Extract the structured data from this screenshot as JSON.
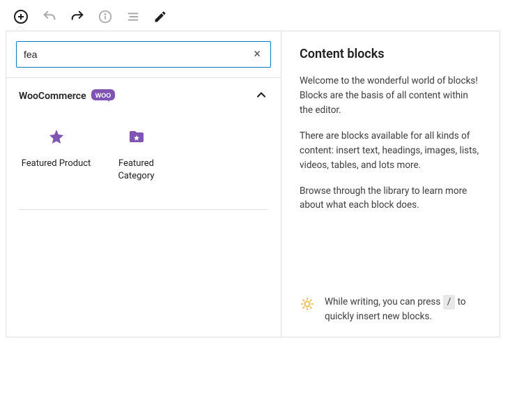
{
  "search": {
    "value": "fea",
    "clear_symbol": "×"
  },
  "category": {
    "name": "WooCommerce"
  },
  "blocks": {
    "featured_product": "Featured Product",
    "featured_category": "Featured Category"
  },
  "sidebar": {
    "title": "Content blocks",
    "p1": "Welcome to the wonderful world of blocks! Blocks are the basis of all content within the editor.",
    "p2": "There are blocks available for all kinds of content: insert text, headings, images, lists, videos, tables, and lots more.",
    "p3": "Browse through the library to learn more about what each block does."
  },
  "tip": {
    "before": "While writing, you can press ",
    "key": "/",
    "after": " to quickly insert new blocks."
  }
}
